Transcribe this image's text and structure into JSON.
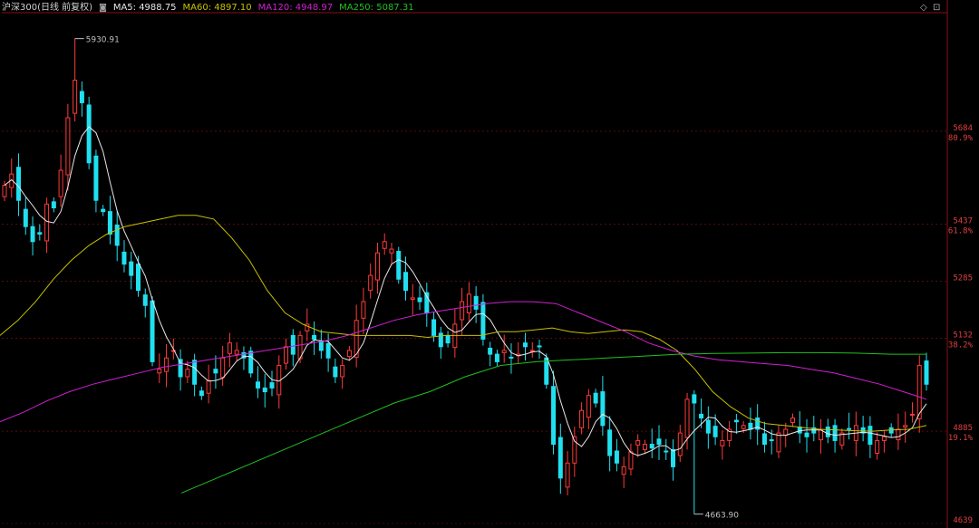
{
  "header": {
    "instrument": "沪深300(日线 前复权)",
    "ma5": "MA5: 4988.75",
    "ma60": "MA60: 4897.10",
    "ma120": "MA120: 4948.97",
    "ma250": "MA250: 5087.31",
    "settings_glyph": "◙",
    "diamond_glyph": "◇",
    "max_glyph": "⊡"
  },
  "colors": {
    "background": "#000000",
    "up": "#ff3a3a",
    "down": "#20e0f0",
    "ma5": "#e8e8e8",
    "ma60": "#c8c000",
    "ma120": "#d020d0",
    "ma250": "#20c020",
    "axis_text": "#e04040",
    "grid": "#8a1010"
  },
  "chart_data": {
    "type": "candlestick",
    "ylim": [
      4639,
      6000
    ],
    "y_ticks": [
      {
        "value": 5684,
        "label": "5684",
        "pct": "80.9%"
      },
      {
        "value": 5437,
        "label": "5437",
        "pct": "61.8%"
      },
      {
        "value": 5285,
        "label": "5285",
        "pct": ""
      },
      {
        "value": 5132,
        "label": "5132",
        "pct": "38.2%"
      },
      {
        "value": 4885,
        "label": "4885",
        "pct": "19.1%"
      },
      {
        "value": 4639,
        "label": "4639",
        "pct": ""
      }
    ],
    "annotations": {
      "high": {
        "label": "5930.91",
        "value": 5930.91,
        "index": 10
      },
      "low": {
        "label": "4663.90",
        "value": 4663.9,
        "index": 98
      }
    },
    "closes": [
      5540,
      5570,
      5500,
      5430,
      5390,
      5410,
      5490,
      5480,
      5580,
      5720,
      5820,
      5760,
      5600,
      5500,
      5470,
      5410,
      5380,
      5330,
      5300,
      5260,
      5220,
      5070,
      5050,
      5080,
      5100,
      5030,
      5050,
      5010,
      4980,
      5020,
      5040,
      5080,
      5120,
      5100,
      5080,
      5040,
      5000,
      4990,
      5000,
      5060,
      5110,
      5090,
      5140,
      5170,
      5130,
      5100,
      5080,
      5030,
      5060,
      5100,
      5180,
      5230,
      5300,
      5360,
      5390,
      5370,
      5290,
      5260,
      5240,
      5230,
      5200,
      5140,
      5110,
      5120,
      5170,
      5230,
      5250,
      5210,
      5130,
      5090,
      5070,
      5100,
      5080,
      5090,
      5110,
      5100,
      5110,
      5010,
      4850,
      4760,
      4800,
      4870,
      4940,
      4980,
      4960,
      4900,
      4820,
      4800,
      4790,
      4830,
      4860,
      4850,
      4840,
      4850,
      4830,
      4790,
      4880,
      4970,
      4960,
      4920,
      4880,
      4870,
      4860,
      4890,
      4910,
      4900,
      4890,
      4890,
      4850,
      4860,
      4880,
      4890,
      4920,
      4880,
      4870,
      4880,
      4890,
      4870,
      4860,
      4880,
      4890,
      4900,
      4880,
      4850,
      4860,
      4870,
      4880,
      4890,
      4900,
      4930,
      5060,
      5010
    ],
    "series": [
      {
        "name": "MA60",
        "values": [
          5140,
          5180,
          5230,
          5290,
          5340,
          5380,
          5410,
          5430,
          5440,
          5450,
          5460,
          5460,
          5450,
          5400,
          5340,
          5260,
          5200,
          5170,
          5150,
          5145,
          5140,
          5140,
          5140,
          5140,
          5135,
          5140,
          5140,
          5140,
          5150,
          5150,
          5155,
          5160,
          5150,
          5145,
          5150,
          5155,
          5150,
          5130,
          5100,
          5050,
          4990,
          4950,
          4920,
          4905,
          4900,
          4895,
          4890,
          4888,
          4886,
          4885,
          4888,
          4890,
          4900
        ]
      },
      {
        "name": "MA120",
        "values": [
          4910,
          4935,
          4965,
          4990,
          5010,
          5025,
          5040,
          5055,
          5065,
          5075,
          5085,
          5095,
          5105,
          5115,
          5125,
          5140,
          5160,
          5180,
          5195,
          5205,
          5215,
          5225,
          5230,
          5230,
          5225,
          5200,
          5175,
          5150,
          5120,
          5100,
          5085,
          5075,
          5070,
          5065,
          5060,
          5050,
          5040,
          5025,
          5010,
          4990,
          4970
        ]
      },
      {
        "name": "MA250",
        "values": [
          4720,
          4760,
          4800,
          4840,
          4880,
          4920,
          4960,
          4990,
          5030,
          5060,
          5070,
          5075,
          5080,
          5085,
          5090,
          5092,
          5093,
          5094,
          5094,
          5093,
          5090,
          5090
        ]
      }
    ]
  }
}
